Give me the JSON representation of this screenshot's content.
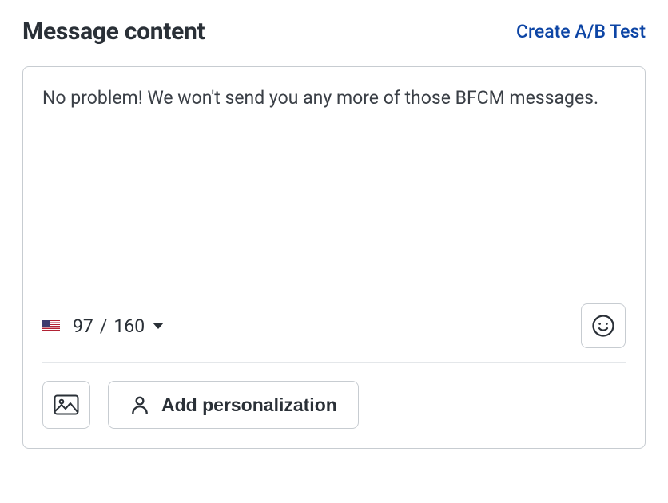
{
  "header": {
    "title": "Message content",
    "ab_link": "Create A/B Test"
  },
  "editor": {
    "message": "No problem! We won't send you any more of those BFCM messages.",
    "counter": {
      "current": "97",
      "separator": "/",
      "max": "160"
    },
    "personalization_label": "Add personalization"
  },
  "icons": {
    "flag": "us-flag-icon",
    "emoji": "smile-icon",
    "image": "image-icon",
    "person": "person-icon",
    "chevron": "chevron-down-icon"
  }
}
